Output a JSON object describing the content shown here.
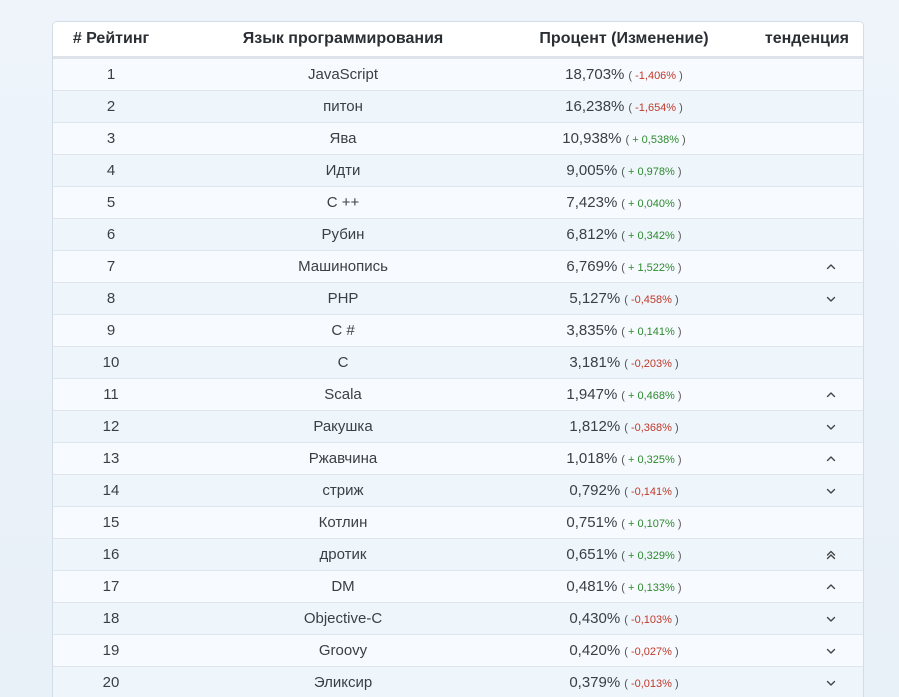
{
  "table": {
    "headers": {
      "rank": "# Рейтинг",
      "language": "Язык программирования",
      "percent": "Процент (Изменение)",
      "trend": "тенденция"
    },
    "rows": [
      {
        "rank": "1",
        "language": "JavaScript",
        "percent": "18,703%",
        "change": "-1,406%",
        "dir": "down",
        "trend": "none"
      },
      {
        "rank": "2",
        "language": "питон",
        "percent": "16,238%",
        "change": "-1,654%",
        "dir": "down",
        "trend": "none"
      },
      {
        "rank": "3",
        "language": "Ява",
        "percent": "10,938%",
        "change": "+ 0,538%",
        "dir": "up",
        "trend": "none"
      },
      {
        "rank": "4",
        "language": "Идти",
        "percent": "9,005%",
        "change": "+ 0,978%",
        "dir": "up",
        "trend": "none"
      },
      {
        "rank": "5",
        "language": "C ++",
        "percent": "7,423%",
        "change": "+ 0,040%",
        "dir": "up",
        "trend": "none"
      },
      {
        "rank": "6",
        "language": "Рубин",
        "percent": "6,812%",
        "change": "+ 0,342%",
        "dir": "up",
        "trend": "none"
      },
      {
        "rank": "7",
        "language": "Машинопись",
        "percent": "6,769%",
        "change": "+ 1,522%",
        "dir": "up",
        "trend": "chevron-up-icon"
      },
      {
        "rank": "8",
        "language": "PHP",
        "percent": "5,127%",
        "change": "-0,458%",
        "dir": "down",
        "trend": "chevron-down-icon"
      },
      {
        "rank": "9",
        "language": "C #",
        "percent": "3,835%",
        "change": "+ 0,141%",
        "dir": "up",
        "trend": "none"
      },
      {
        "rank": "10",
        "language": "C",
        "percent": "3,181%",
        "change": "-0,203%",
        "dir": "down",
        "trend": "none"
      },
      {
        "rank": "11",
        "language": "Scala",
        "percent": "1,947%",
        "change": "+ 0,468%",
        "dir": "up",
        "trend": "chevron-up-icon"
      },
      {
        "rank": "12",
        "language": "Ракушка",
        "percent": "1,812%",
        "change": "-0,368%",
        "dir": "down",
        "trend": "chevron-down-icon"
      },
      {
        "rank": "13",
        "language": "Ржавчина",
        "percent": "1,018%",
        "change": "+ 0,325%",
        "dir": "up",
        "trend": "chevron-up-icon"
      },
      {
        "rank": "14",
        "language": "стриж",
        "percent": "0,792%",
        "change": "-0,141%",
        "dir": "down",
        "trend": "chevron-down-icon"
      },
      {
        "rank": "15",
        "language": "Котлин",
        "percent": "0,751%",
        "change": "+ 0,107%",
        "dir": "up",
        "trend": "none"
      },
      {
        "rank": "16",
        "language": "дротик",
        "percent": "0,651%",
        "change": "+ 0,329%",
        "dir": "up",
        "trend": "double-chevron-up-icon"
      },
      {
        "rank": "17",
        "language": "DM",
        "percent": "0,481%",
        "change": "+ 0,133%",
        "dir": "up",
        "trend": "chevron-up-icon"
      },
      {
        "rank": "18",
        "language": "Objective-C",
        "percent": "0,430%",
        "change": "-0,103%",
        "dir": "down",
        "trend": "chevron-down-icon"
      },
      {
        "rank": "19",
        "language": "Groovy",
        "percent": "0,420%",
        "change": "-0,027%",
        "dir": "down",
        "trend": "chevron-down-icon"
      },
      {
        "rank": "20",
        "language": "Эликсир",
        "percent": "0,379%",
        "change": "-0,013%",
        "dir": "down",
        "trend": "chevron-down-icon"
      }
    ]
  },
  "colors": {
    "positive": "#2d8a2d",
    "negative": "#c0392b"
  }
}
